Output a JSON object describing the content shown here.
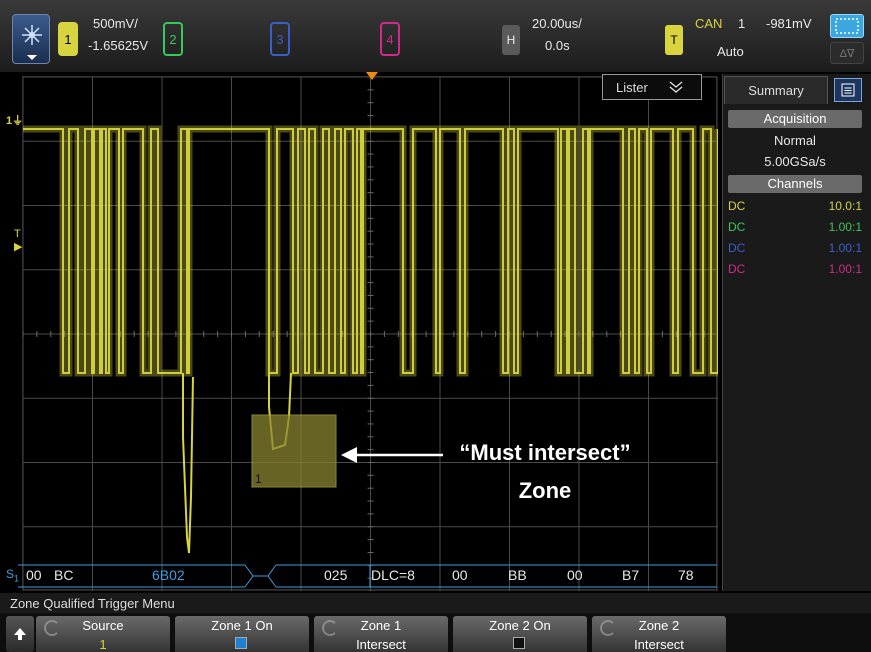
{
  "topbar": {
    "ch1_num": "1",
    "ch1_scale": "500mV/",
    "ch1_offset": "-1.65625V",
    "ch2_num": "2",
    "ch3_num": "3",
    "ch4_num": "4",
    "h_label": "H",
    "h_timebase": "20.00us/",
    "h_delay": "0.0s",
    "t_label": "T",
    "trig_type": "CAN",
    "trig_source": "1",
    "trig_level": "-981mV",
    "trig_mode": "Auto",
    "meas_label": "Δ∇"
  },
  "waveform": {
    "marker_1": "1",
    "marker_t": "T",
    "zone_label": "1",
    "lister_label": "Lister",
    "lister_icon": "chevron-double-down-icon"
  },
  "sidepanel": {
    "tab_label": "Summary",
    "acq_header": "Acquisition",
    "acq_mode": "Normal",
    "acq_rate": "5.00GSa/s",
    "channels_header": "Channels",
    "channels": [
      {
        "coupling": "DC",
        "probe": "10.0:1",
        "color": "#d8d440"
      },
      {
        "coupling": "DC",
        "probe": "1.00:1",
        "color": "#39c85a"
      },
      {
        "coupling": "DC",
        "probe": "1.00:1",
        "color": "#3a5fc9"
      },
      {
        "coupling": "DC",
        "probe": "1.00:1",
        "color": "#d02a8d"
      }
    ]
  },
  "bus": {
    "label": "S1",
    "fields": [
      "00",
      "BC",
      "6B02",
      "025",
      "DLC=8",
      "00",
      "BB",
      "00",
      "B7",
      "78"
    ]
  },
  "annotation": {
    "line1": "“Must intersect”",
    "line2": "Zone"
  },
  "softkeys": {
    "menu_title": "Zone Qualified Trigger Menu",
    "keys": [
      {
        "top": "Source",
        "bottom": "1"
      },
      {
        "top": "Zone 1 On",
        "bottom": ""
      },
      {
        "top": "Zone 1",
        "bottom": "Intersect"
      },
      {
        "top": "Zone 2 On",
        "bottom": ""
      },
      {
        "top": "Zone 2",
        "bottom": "Intersect"
      }
    ]
  },
  "colors": {
    "ch1": "#d8d440",
    "ch2": "#39c85a",
    "ch3": "#3a5fc9",
    "ch4": "#d02a8d",
    "bus": "#3a9fe0",
    "accent": "#3aa7e0"
  }
}
